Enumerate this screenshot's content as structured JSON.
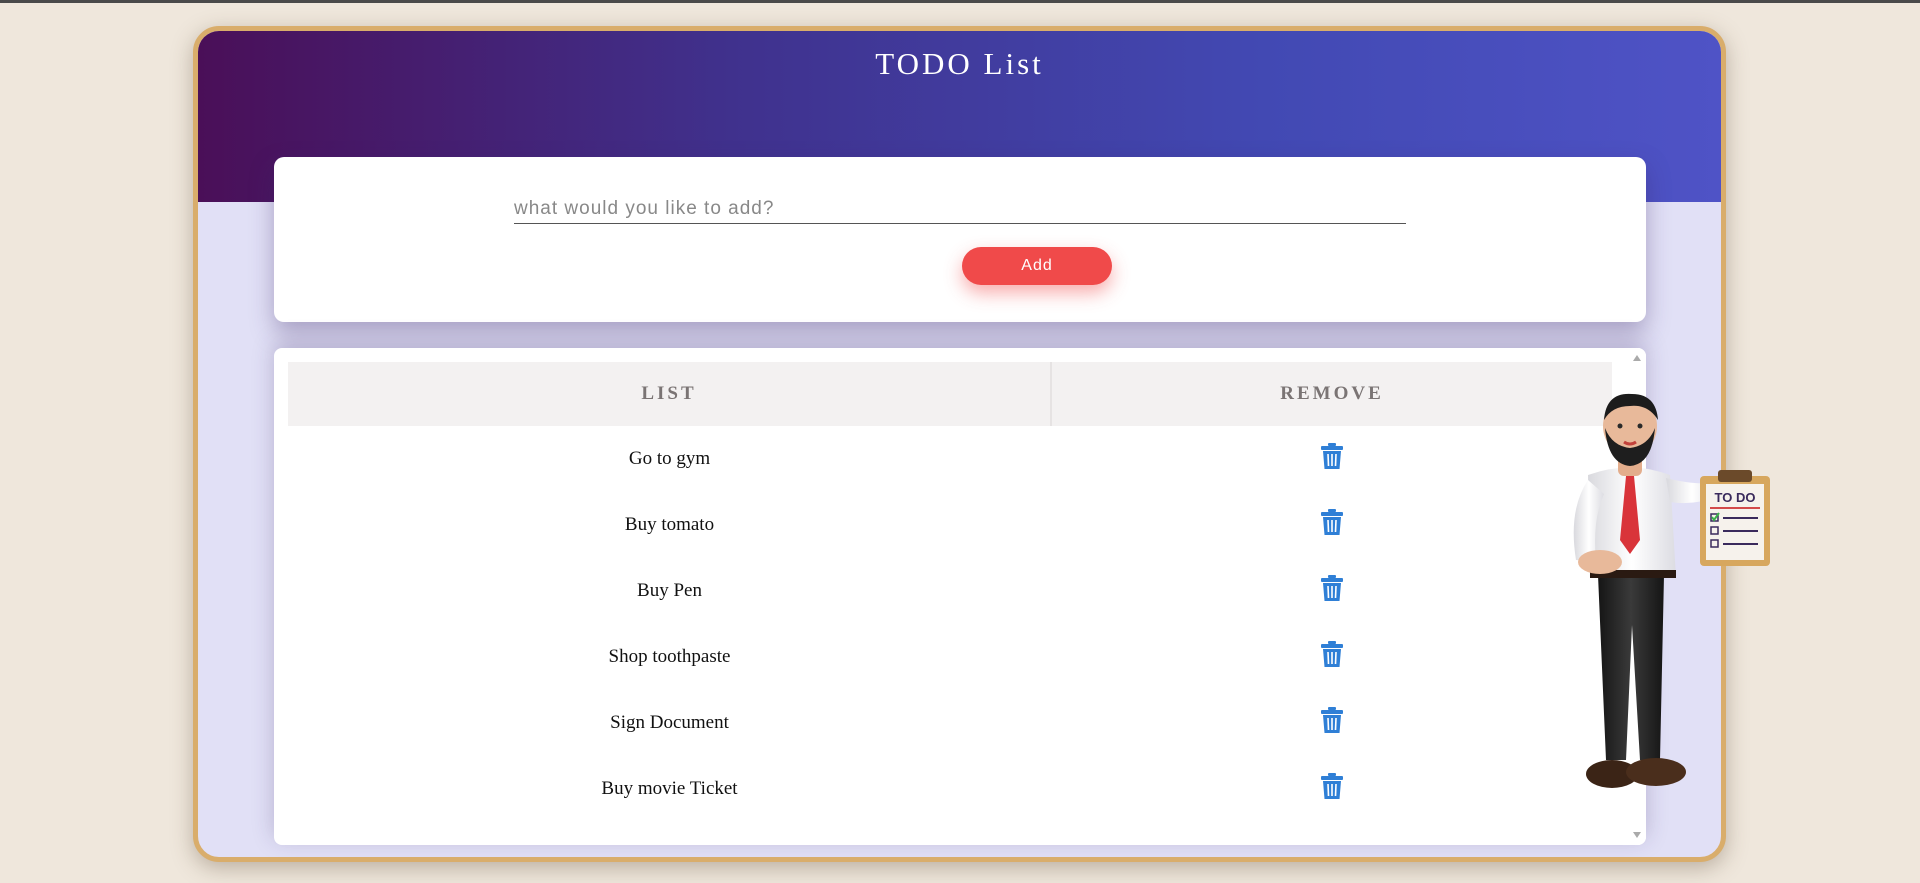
{
  "app": {
    "title": "TODO List"
  },
  "add_form": {
    "placeholder": "what would you like to add?",
    "value": "",
    "button_label": "Add"
  },
  "table": {
    "headers": [
      "LIST",
      "REMOVE"
    ],
    "rows": [
      {
        "task": "Go to gym",
        "remove_icon": "trash-icon"
      },
      {
        "task": "Buy tomato",
        "remove_icon": "trash-icon"
      },
      {
        "task": "Buy Pen",
        "remove_icon": "trash-icon"
      },
      {
        "task": "Shop toothpaste",
        "remove_icon": "trash-icon"
      },
      {
        "task": "Sign Document",
        "remove_icon": "trash-icon"
      },
      {
        "task": "Buy movie Ticket",
        "remove_icon": "trash-icon"
      }
    ]
  },
  "illustration": {
    "clipboard_text": "TO DO"
  },
  "colors": {
    "accent_button": "#f04a4a",
    "header_gradient_start": "#4a0f58",
    "header_gradient_end": "#4f53c6",
    "trash_icon": "#2f7fd6",
    "frame_border": "#d9ad6b"
  }
}
